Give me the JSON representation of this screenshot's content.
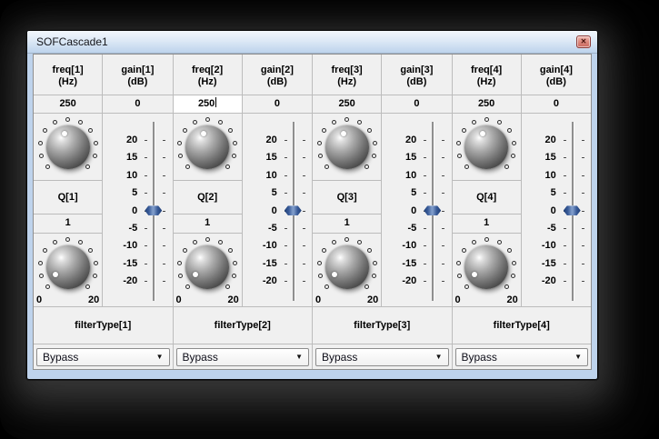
{
  "window": {
    "title": "SOFCascade1"
  },
  "icons": {
    "close": "✕",
    "dropdown_arrow": "▼"
  },
  "colors": {
    "window_frame": "#bed3ec",
    "titlebar_top": "#f3f7fc",
    "titlebar_bottom": "#bdd3ec",
    "panel": "#f0f0f0",
    "grid_line": "#bcbcbc",
    "slider_thumb": "#3a5c99",
    "close_button": "#dd8b80"
  },
  "slider": {
    "ticks": [
      "20",
      "15",
      "10",
      "5",
      "0",
      "-5",
      "-10",
      "-15",
      "-20"
    ],
    "value": "0"
  },
  "channels": [
    {
      "freq_label": "freq[1]",
      "freq_unit": "(Hz)",
      "freq_value": "250",
      "freq_editing": false,
      "gain_label": "gain[1]",
      "gain_unit": "(dB)",
      "gain_value": "0",
      "q_label": "Q[1]",
      "q_value": "1",
      "q_min": "0",
      "q_max": "20",
      "filter_label": "filterType[1]",
      "filter_value": "Bypass",
      "freq_knob_angle": -15,
      "q_knob_angle": -122
    },
    {
      "freq_label": "freq[2]",
      "freq_unit": "(Hz)",
      "freq_value": "250",
      "freq_editing": true,
      "gain_label": "gain[2]",
      "gain_unit": "(dB)",
      "gain_value": "0",
      "q_label": "Q[2]",
      "q_value": "1",
      "q_min": "0",
      "q_max": "20",
      "filter_label": "filterType[2]",
      "filter_value": "Bypass",
      "freq_knob_angle": -15,
      "q_knob_angle": -122
    },
    {
      "freq_label": "freq[3]",
      "freq_unit": "(Hz)",
      "freq_value": "250",
      "freq_editing": false,
      "gain_label": "gain[3]",
      "gain_unit": "(dB)",
      "gain_value": "0",
      "q_label": "Q[3]",
      "q_value": "1",
      "q_min": "0",
      "q_max": "20",
      "filter_label": "filterType[3]",
      "filter_value": "Bypass",
      "freq_knob_angle": -15,
      "q_knob_angle": -122
    },
    {
      "freq_label": "freq[4]",
      "freq_unit": "(Hz)",
      "freq_value": "250",
      "freq_editing": false,
      "gain_label": "gain[4]",
      "gain_unit": "(dB)",
      "gain_value": "0",
      "q_label": "Q[4]",
      "q_value": "1",
      "q_min": "0",
      "q_max": "20",
      "filter_label": "filterType[4]",
      "filter_value": "Bypass",
      "freq_knob_angle": -15,
      "q_knob_angle": -122
    }
  ]
}
